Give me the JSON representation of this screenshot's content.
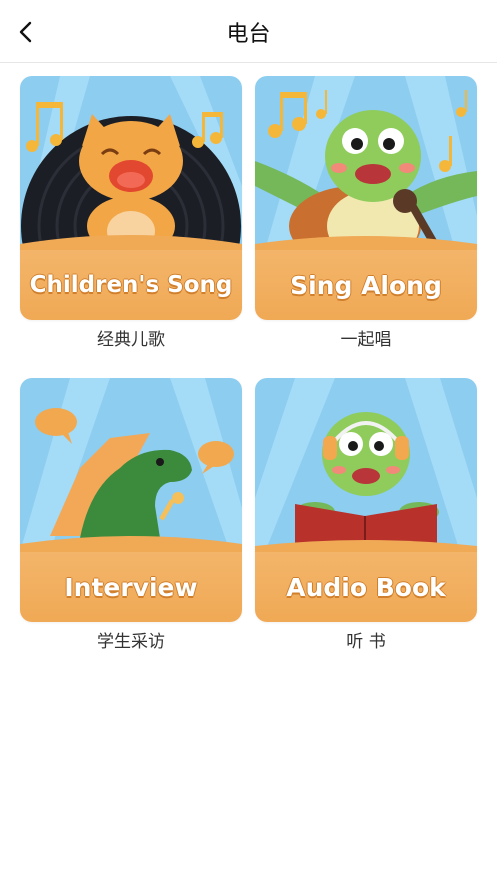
{
  "header": {
    "title": "电台",
    "back_icon": "chevron-left-icon"
  },
  "cards": [
    {
      "banner": "Children's Song",
      "caption": "经典儿歌",
      "character": "cat"
    },
    {
      "banner": "Sing Along",
      "caption": "一起唱",
      "character": "turtle"
    },
    {
      "banner": "Interview",
      "caption": "学生采访",
      "character": "dinosaur"
    },
    {
      "banner": "Audio Book",
      "caption": "听 书",
      "character": "turtle-reading"
    }
  ],
  "colors": {
    "banner": "#f0a955",
    "banner_shadow": "#d07f2c",
    "sky": "#7ec4ea",
    "sky_light": "#a9dcf5"
  }
}
